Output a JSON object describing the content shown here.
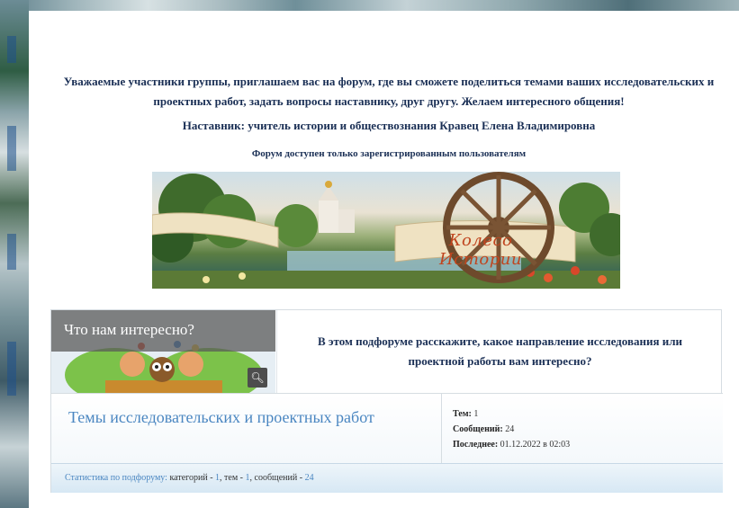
{
  "intro": {
    "line1": "Уважаемые участники группы, приглашаем вас на форум, где вы сможете поделиться темами ваших исследовательских и",
    "line2": "проектных работ, задать вопросы наставнику, друг другу. Желаем интересного общения!"
  },
  "mentor": "Наставник: учитель истории и обществознания Кравец Елена Владимировна",
  "notice": "Форум доступен только зарегистрированным пользователям",
  "banner": {
    "title": "Колесо Истории"
  },
  "category": {
    "title": "Что нам интересно?",
    "zoom_icon": "search-icon",
    "description_line1": "В этом подфоруме расскажите, какое направление исследования или",
    "description_line2": "проектной работы вам интересно?"
  },
  "topic": {
    "name": "Темы исследовательских и проектных работ",
    "topics_label": "Тем:",
    "topics_value": "1",
    "messages_label": "Сообщений:",
    "messages_value": "24",
    "last_label": "Последнее:",
    "last_value": "01.12.2022 в 02:03"
  },
  "stats": {
    "label": "Статистика по подфоруму:",
    "categories_text": "категорий -",
    "categories_value": "1",
    "topics_text": ", тем -",
    "topics_value": "1",
    "messages_text": ", сообщений -",
    "messages_value": "24"
  },
  "colors": {
    "heading": "#1a2f55",
    "link": "#4a86c1",
    "banner_title": "#c0451f"
  }
}
